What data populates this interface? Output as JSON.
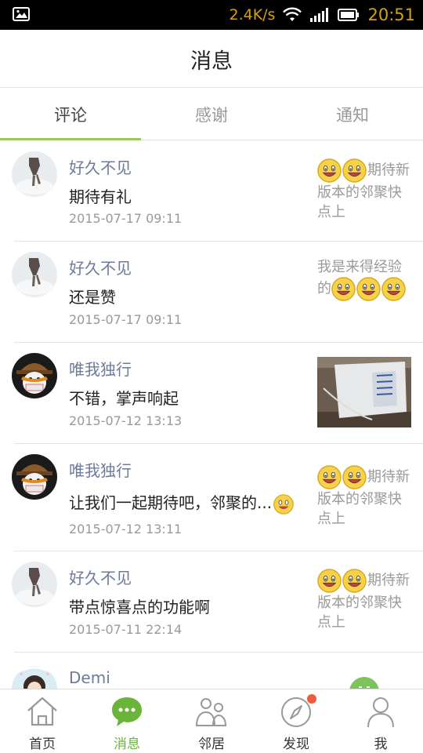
{
  "status_bar": {
    "speed": "2.4K/s",
    "time": "20:51"
  },
  "header": {
    "title": "消息"
  },
  "tabs": [
    {
      "label": "评论",
      "active": true
    },
    {
      "label": "感谢",
      "active": false
    },
    {
      "label": "通知",
      "active": false
    }
  ],
  "comments": [
    {
      "user": "好久不见",
      "message": "期待有礼",
      "time": "2015-07-17 09:11",
      "aside_text": "期待新版本的邻聚快点上"
    },
    {
      "user": "好久不见",
      "message": "还是赞",
      "time": "2015-07-17 09:11",
      "aside_text": "我是来得经验的"
    },
    {
      "user": "唯我独行",
      "message": "不错，掌声响起",
      "time": "2015-07-12 13:13",
      "aside_text": ""
    },
    {
      "user": "唯我独行",
      "message": "让我们一起期待吧，邻聚的...",
      "time": "2015-07-12 13:11",
      "aside_text": "期待新版本的邻聚快点上"
    },
    {
      "user": "好久不见",
      "message": "带点惊喜点的功能啊",
      "time": "2015-07-11 22:14",
      "aside_text": "期待新版本的邻聚快点上"
    },
    {
      "user": "Demi",
      "message": "",
      "time": "",
      "aside_text": ""
    }
  ],
  "bottom_nav": [
    {
      "label": "首页",
      "icon": "home-icon"
    },
    {
      "label": "消息",
      "icon": "chat-icon",
      "active": true
    },
    {
      "label": "邻居",
      "icon": "neighbors-icon"
    },
    {
      "label": "发现",
      "icon": "compass-icon",
      "badge": true
    },
    {
      "label": "我",
      "icon": "user-icon"
    }
  ],
  "colors": {
    "accent": "#6ab43a",
    "tab_underline": "#9bc85a",
    "name": "#6d7a9c",
    "badge": "#f05a3a"
  }
}
